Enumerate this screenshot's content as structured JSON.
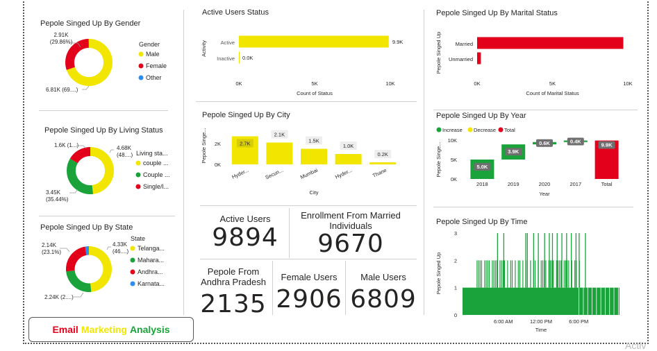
{
  "colors": {
    "yellow": "#f2e600",
    "red": "#e3001b",
    "green": "#1aa33a",
    "blue": "#2f8cf0",
    "gray_label": "#757575",
    "text": "#252423"
  },
  "titles": {
    "gender": "Pepole Singed Up By Gender",
    "living": "Pepole Singed Up By Living Status",
    "state": "Pepole Singed Up By State",
    "active": "Active Users Status",
    "city": "Pepole Singed Up By City",
    "marital": "Pepole Singed Up By Marital Status",
    "year": "Pepole Singed Up By Year",
    "time": "Pepole Singed Up By Time"
  },
  "kpis": {
    "active_users": {
      "label": "Active Users",
      "value": "9894"
    },
    "married_enroll": {
      "label": "Enrollment From Married Individuals",
      "value": "9670"
    },
    "andhra": {
      "label": "Pepole From Andhra Pradesh",
      "value": "2135"
    },
    "female": {
      "label": "Female Users",
      "value": "2906"
    },
    "male": {
      "label": "Male Users",
      "value": "6809"
    }
  },
  "brand": {
    "word1": "Email",
    "word2": "Marketing",
    "word3": "Analysis"
  },
  "watermark": "Activ",
  "chart_data": [
    {
      "id": "gender",
      "type": "pie",
      "legend_title": "Gender",
      "slices": [
        {
          "label": "Male",
          "value": 6810,
          "text": "6.81K (69....)",
          "color": "#f2e600"
        },
        {
          "label": "Female",
          "value": 2910,
          "text": "2.91K (29.86%)",
          "color": "#e3001b"
        },
        {
          "label": "Other",
          "value": 30,
          "text": "",
          "color": "#2f8cf0"
        }
      ]
    },
    {
      "id": "living",
      "type": "pie",
      "legend_title": "Living sta...",
      "slices": [
        {
          "label": "couple ...",
          "value": 4680,
          "text": "4.68K (48....)",
          "color": "#f2e600"
        },
        {
          "label": "Couple ...",
          "value": 3450,
          "text": "3.45K (35.44%)",
          "color": "#1aa33a"
        },
        {
          "label": "Single/l...",
          "value": 1600,
          "text": "1.6K (1...)",
          "color": "#e3001b"
        }
      ]
    },
    {
      "id": "state",
      "type": "pie",
      "legend_title": "State",
      "slices": [
        {
          "label": "Telanga...",
          "value": 4330,
          "text": "4.33K (46....)",
          "color": "#f2e600"
        },
        {
          "label": "Mahara...",
          "value": 2240,
          "text": "2.24K (2....)",
          "color": "#1aa33a"
        },
        {
          "label": "Andhra...",
          "value": 2140,
          "text": "2.14K (23.1%)",
          "color": "#e3001b"
        },
        {
          "label": "Karnata...",
          "value": 240,
          "text": "",
          "color": "#2f8cf0"
        }
      ]
    },
    {
      "id": "active",
      "type": "bar",
      "orientation": "horizontal",
      "categories": [
        "Active",
        "Inactive"
      ],
      "values": [
        9900,
        0
      ],
      "value_labels": [
        "9.9K",
        "0.0K"
      ],
      "xlabel": "Count of Status",
      "ylabel": "Activity",
      "xlim": [
        0,
        10000
      ],
      "ticks": [
        0,
        5000,
        10000
      ],
      "tick_labels": [
        "0K",
        "5K",
        "10K"
      ]
    },
    {
      "id": "city",
      "type": "bar",
      "categories": [
        "Hyder...",
        "Secun...",
        "Mumbai",
        "Hyder...",
        "Thane"
      ],
      "values": [
        2700,
        2100,
        1500,
        1000,
        200
      ],
      "value_labels": [
        "2.7K",
        "2.1K",
        "1.5K",
        "1.0K",
        "0.2K"
      ],
      "xlabel": "City",
      "ylabel": "Pepole Singe...",
      "ylim": [
        0,
        3000
      ],
      "ticks": [
        0,
        2000
      ],
      "tick_labels": [
        "0K",
        "2K"
      ]
    },
    {
      "id": "marital",
      "type": "bar",
      "orientation": "horizontal",
      "categories": [
        "Married",
        "Unmarried"
      ],
      "values": [
        9700,
        250
      ],
      "xlabel": "Count of Marital Status",
      "ylabel": "Pepole Singed Up",
      "xlim": [
        0,
        10000
      ],
      "ticks": [
        0,
        5000,
        10000
      ],
      "tick_labels": [
        "0K",
        "5K",
        "10K"
      ]
    },
    {
      "id": "year",
      "type": "waterfall",
      "legend": [
        "Increase",
        "Decrease",
        "Total"
      ],
      "categories": [
        "2018",
        "2019",
        "2020",
        "2017",
        "Total"
      ],
      "values": [
        5000,
        3900,
        600,
        400,
        9900
      ],
      "value_labels": [
        "5.0K",
        "3.9K",
        "0.6K",
        "0.4K",
        "9.9K"
      ],
      "xlabel": "Year",
      "ylabel": "Pepole Singe...",
      "ylim": [
        0,
        10000
      ],
      "ticks": [
        0,
        5000,
        10000
      ],
      "tick_labels": [
        "0K",
        "5K",
        "10K"
      ]
    },
    {
      "id": "time",
      "type": "bar",
      "xlabel": "Time",
      "ylabel": "Pepole Singed Up",
      "ylim": [
        0,
        3
      ],
      "ticks": [
        0,
        1,
        2,
        3
      ],
      "tick_labels": [
        "0",
        "1",
        "2",
        "3"
      ],
      "x_tick_labels": [
        "6:00 AM",
        "12:00 PM",
        "6:00 PM"
      ],
      "spans_at_2": [
        [
          0.08,
          0.75
        ]
      ],
      "spikes_at_3": [
        0.22,
        0.26,
        0.4,
        0.41,
        0.45,
        0.48,
        0.52,
        0.55,
        0.57,
        0.6,
        0.63,
        0.66,
        0.69,
        0.72,
        0.74,
        0.78
      ]
    }
  ]
}
